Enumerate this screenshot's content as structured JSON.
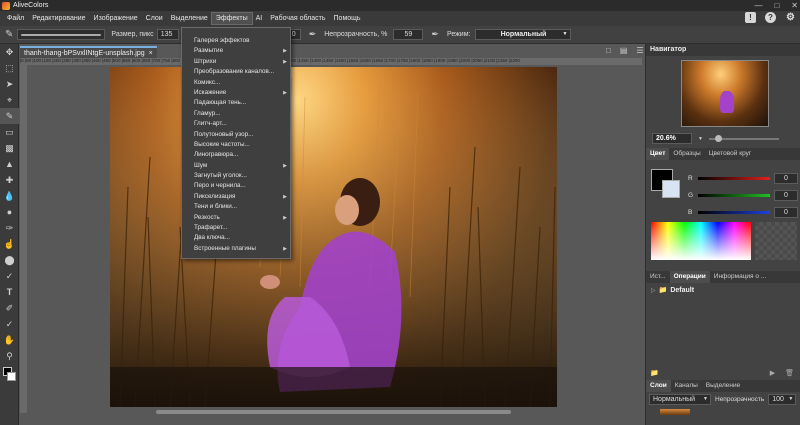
{
  "app": {
    "title": "AliveColors"
  },
  "menu": [
    "Файл",
    "Редактирование",
    "Изображение",
    "Слои",
    "Выделение",
    "Эффекты",
    "AI",
    "Рабочая область",
    "Помощь"
  ],
  "options": {
    "size_label": "Размер, пикс",
    "size_value": "135",
    "second_value": "0",
    "opacity_label": "Непрозрачность, %",
    "opacity_value": "59",
    "mode_label": "Режим:",
    "mode_value": "Нормальный"
  },
  "doc": {
    "tab_name": "thanh-thang-bPSvxlINtgE-unsplash.jpg",
    "ruler": "|0 |50 |100 |150 |200 |250 |300 |350 |400 |450 |500 |550 |600 |650 |700 |750 |800 |850 |900 |950 |1000 |1050 |1100 |1150 |1200 |1250 |1300 |1350 |1400 |1450 |1500 |1550 |1600 |1650 |1700 |1750 |1800 |1850 |1900 |1950 |2000 |2050 |2100 |2150 |2200"
  },
  "effects_menu": [
    {
      "label": "Галерея эффектов",
      "sub": false,
      "hl": false,
      "dim": false
    },
    {
      "label": "Размытие",
      "sub": true,
      "hl": false,
      "dim": false
    },
    {
      "label": "Штрихи",
      "sub": true,
      "hl": false,
      "dim": false
    },
    {
      "label": "Преобразование каналов...",
      "sub": false,
      "hl": false,
      "dim": false
    },
    {
      "label": "Комикс...",
      "sub": false,
      "hl": false,
      "dim": false
    },
    {
      "label": "Искажение",
      "sub": true,
      "hl": false,
      "dim": false
    },
    {
      "label": "Падающая тень...",
      "sub": false,
      "hl": false,
      "dim": false
    },
    {
      "label": "Гламур...",
      "sub": false,
      "hl": false,
      "dim": false
    },
    {
      "label": "Глитч-арт...",
      "sub": false,
      "hl": false,
      "dim": false
    },
    {
      "label": "Полутоновый узор...",
      "sub": false,
      "hl": false,
      "dim": false
    },
    {
      "label": "Высокие частоты...",
      "sub": false,
      "hl": false,
      "dim": false
    },
    {
      "label": "Линогравюра...",
      "sub": false,
      "hl": false,
      "dim": false
    },
    {
      "label": "Шум",
      "sub": true,
      "hl": false,
      "dim": false
    },
    {
      "label": "Загнутый уголок...",
      "sub": false,
      "hl": false,
      "dim": false
    },
    {
      "label": "Перо и чернила...",
      "sub": false,
      "hl": false,
      "dim": false
    },
    {
      "label": "Пикселизация",
      "sub": true,
      "hl": false,
      "dim": false
    },
    {
      "label": "Тени и блики...",
      "sub": false,
      "hl": false,
      "dim": false
    },
    {
      "label": "Резкость",
      "sub": true,
      "hl": false,
      "dim": false
    },
    {
      "label": "Трафарет...",
      "sub": false,
      "hl": false,
      "dim": false
    },
    {
      "label": "Два ключа...",
      "sub": false,
      "hl": false,
      "dim": false
    },
    {
      "label": "Встроенные плагины",
      "sub": true,
      "hl": false,
      "dim": false
    }
  ],
  "navigator": {
    "title": "Навигатор",
    "zoom": "20.6%"
  },
  "color_panel": {
    "tabs": [
      "Цвет",
      "Образцы",
      "Цветовой круг"
    ],
    "channels": [
      {
        "name": "R",
        "value": "0",
        "color": "#e02020"
      },
      {
        "name": "G",
        "value": "0",
        "color": "#20c020"
      },
      {
        "name": "B",
        "value": "0",
        "color": "#2040e0"
      }
    ]
  },
  "ops_panel": {
    "tabs": [
      "Ист...",
      "Операции",
      "Информация о ..."
    ],
    "item": "Default"
  },
  "layers_panel": {
    "tabs": [
      "Слои",
      "Каналы",
      "Выделение"
    ],
    "blend": "Нормальный",
    "opacity_label": "Непрозрачность",
    "opacity_value": "100"
  }
}
